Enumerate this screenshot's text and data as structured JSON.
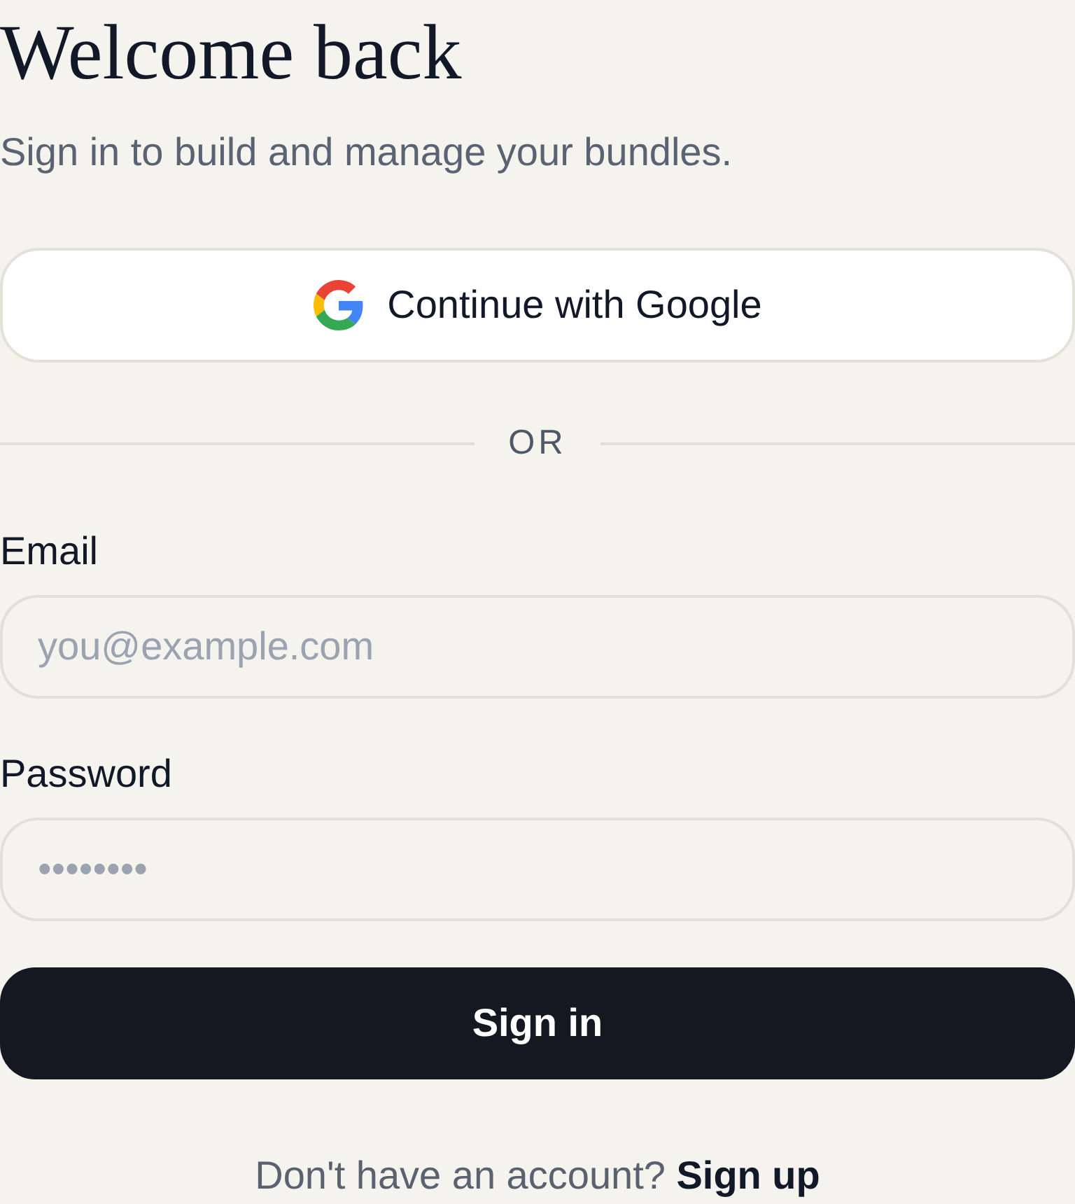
{
  "heading": {
    "title": "Welcome back",
    "subtitle": "Sign in to build and manage your bundles."
  },
  "google_button": {
    "label": "Continue with Google"
  },
  "divider": {
    "label": "OR"
  },
  "fields": [
    {
      "label": "Email",
      "placeholder": "you@example.com"
    },
    {
      "label": "Password",
      "placeholder": "••••••••"
    }
  ],
  "submit_button": {
    "label": "Sign in"
  },
  "footer": {
    "text": "Don't have an account?",
    "link": "Sign up"
  }
}
